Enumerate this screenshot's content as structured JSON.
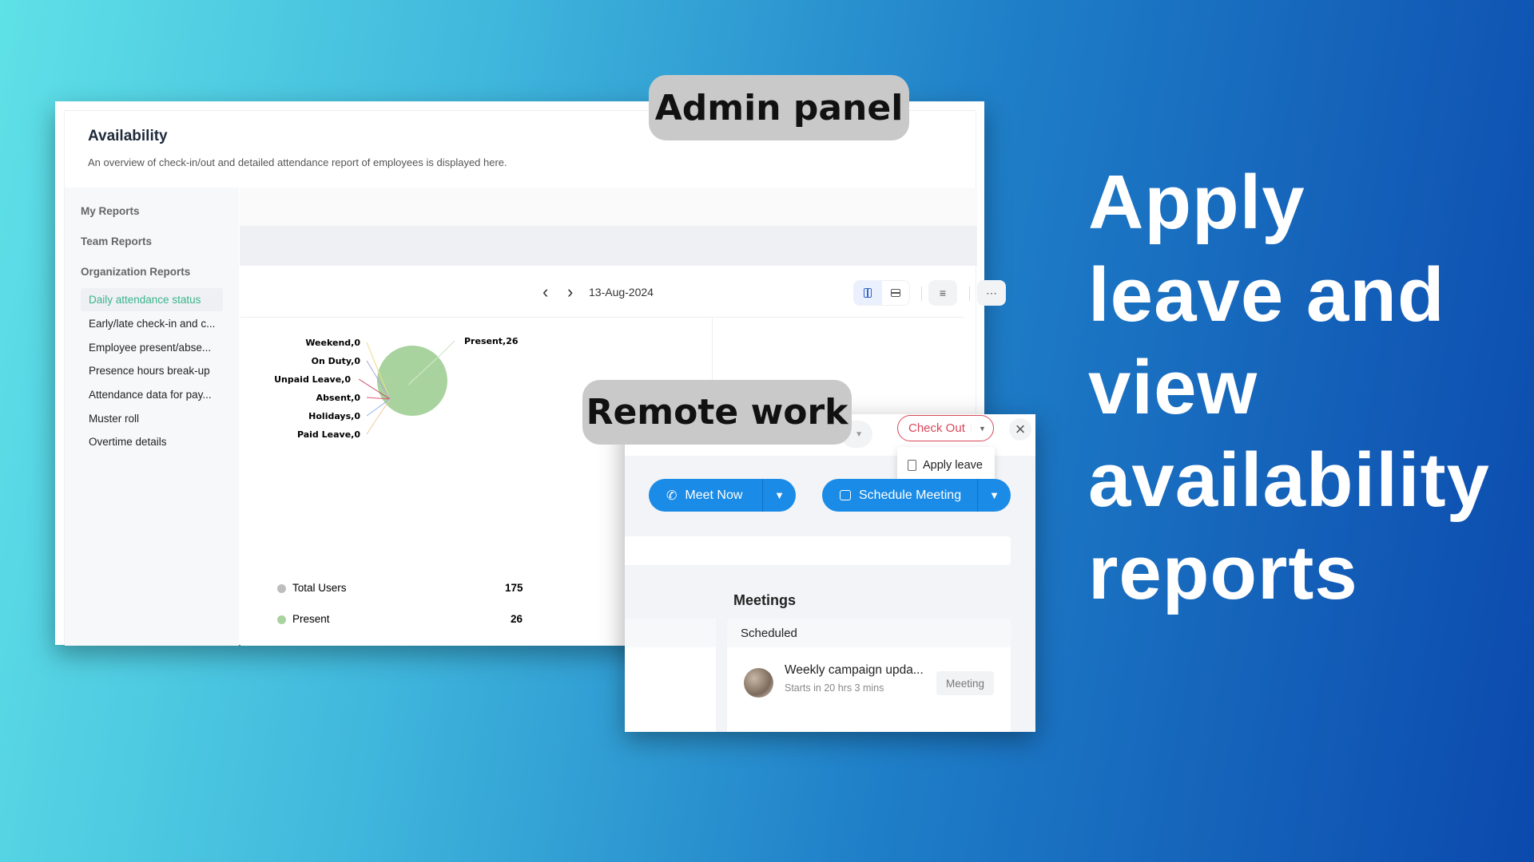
{
  "labels": {
    "admin": "Admin panel",
    "remote": "Remote work"
  },
  "headline": [
    "Apply",
    "leave and",
    "view",
    "availability",
    "reports"
  ],
  "admin": {
    "title": "Availability",
    "description": "An overview of check-in/out and detailed attendance report of employees is displayed here.",
    "sidebar": {
      "my_reports": "My Reports",
      "team_reports": "Team Reports",
      "org_reports": "Organization Reports",
      "items": [
        "Daily attendance status",
        "Early/late check-in and c...",
        "Employee present/abse...",
        "Presence hours break-up",
        "Attendance data for pay...",
        "Muster roll",
        "Overtime details"
      ],
      "selected": 0
    },
    "toolbar": {
      "date": "13-Aug-2024",
      "prev": "‹",
      "next": "›",
      "more": "⋯"
    },
    "legend": [
      {
        "label": "Total Users",
        "value": "175",
        "color": "#bdbdbd"
      },
      {
        "label": "Present",
        "value": "26",
        "color": "#a9d39e"
      }
    ]
  },
  "chart_data": {
    "type": "pie",
    "slices": [
      {
        "label": "Present",
        "value": 26,
        "text": "Present,26",
        "color": "#a9d39e"
      },
      {
        "label": "Weekend",
        "value": 0,
        "text": "Weekend,0",
        "color": "#f2d98a"
      },
      {
        "label": "On Duty",
        "value": 0,
        "text": "On Duty,0",
        "color": "#a6a4d8"
      },
      {
        "label": "Unpaid Leave",
        "value": 0,
        "text": "Unpaid Leave,0",
        "color": "#c7425e"
      },
      {
        "label": "Absent",
        "value": 0,
        "text": "Absent,0",
        "color": "#e0576c"
      },
      {
        "label": "Holidays",
        "value": 0,
        "text": "Holidays,0",
        "color": "#8fb4e6"
      },
      {
        "label": "Paid Leave",
        "value": 0,
        "text": "Paid Leave,0",
        "color": "#f3c89a"
      }
    ]
  },
  "remote": {
    "check_out": "Check Out",
    "apply_leave": "Apply leave",
    "meet_now": "Meet Now",
    "schedule_meeting": "Schedule Meeting",
    "meetings_title": "Meetings",
    "scheduled": "Scheduled",
    "meeting": {
      "title": "Weekly campaign upda...",
      "subtitle": "Starts in 20 hrs 3 mins",
      "badge": "Meeting"
    }
  },
  "colors": {
    "accent_green": "#3bb48a",
    "primary_blue": "#1a8be6",
    "checkout_red": "#d9475b"
  }
}
